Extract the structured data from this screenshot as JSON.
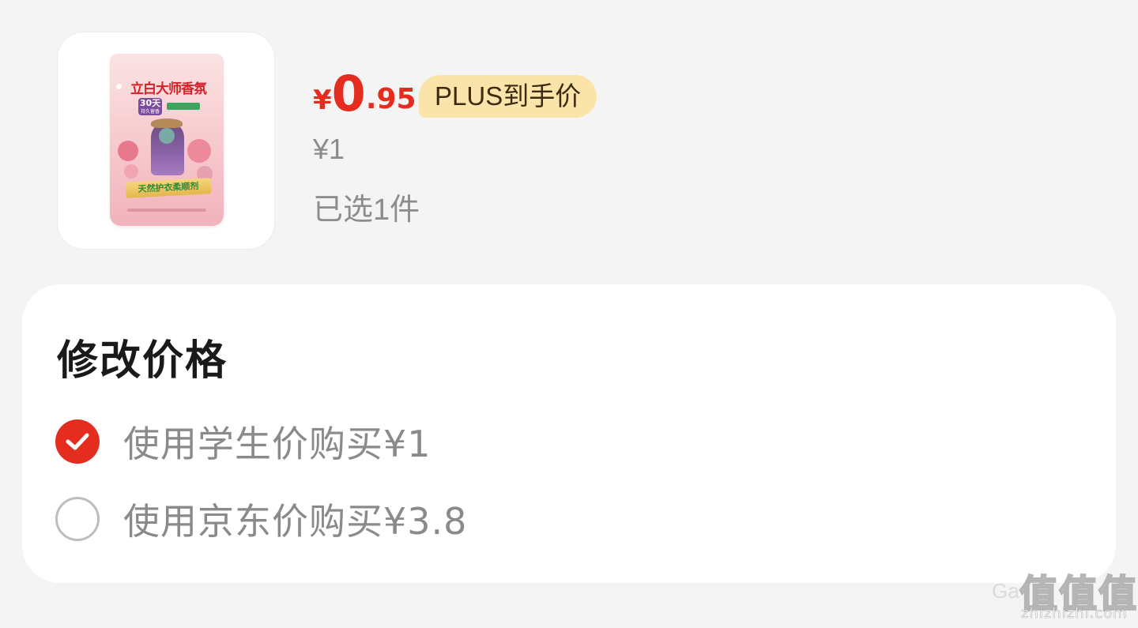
{
  "product": {
    "image_alt": "立白大师香氛 天然护衣柔顺剂",
    "price_yen": "¥",
    "price_int": "0",
    "price_dec": ".95",
    "price_tag": "PLUS到手价",
    "original_price": "¥1",
    "selected_count": "已选1件",
    "bag_text": {
      "brand": "立白大师香氛",
      "badge_days": "30天",
      "badge_sub": "持久留香",
      "banner": "天然护衣柔顺剂"
    }
  },
  "modify_price": {
    "title": "修改价格",
    "options": [
      {
        "label": "使用学生价购买¥1",
        "checked": true
      },
      {
        "label": "使用京东价购买¥3.8",
        "checked": false
      }
    ]
  },
  "watermark": {
    "logo": "值值值",
    "url": "zhizhizhi.com",
    "ga": "Ga"
  },
  "colors": {
    "accent_red": "#e52d1f",
    "plus_tag_bg": "#fbe4aa",
    "background": "#f4f4f4"
  }
}
